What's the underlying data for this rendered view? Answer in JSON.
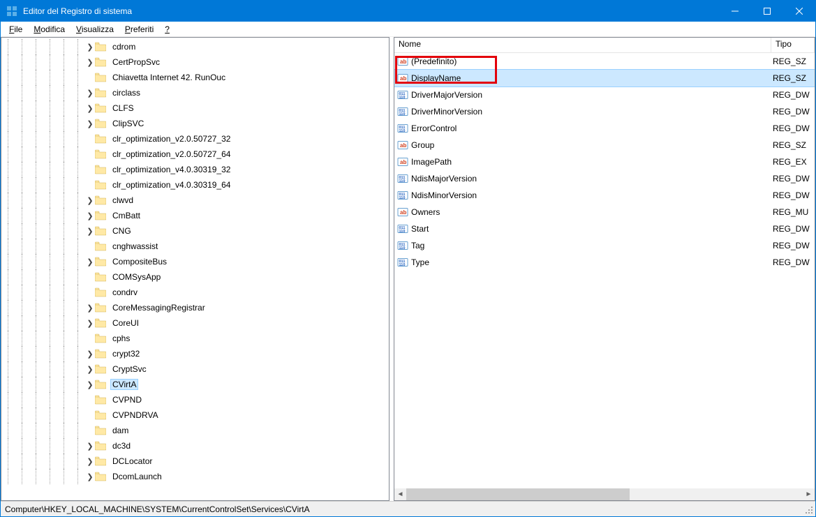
{
  "window": {
    "title": "Editor del Registro di sistema"
  },
  "menu": {
    "items": [
      {
        "label": "File",
        "accel": "F"
      },
      {
        "label": "Modifica",
        "accel": "M"
      },
      {
        "label": "Visualizza",
        "accel": "V"
      },
      {
        "label": "Preferiti",
        "accel": "P"
      },
      {
        "label": "?",
        "accel": "?"
      }
    ]
  },
  "tree": {
    "items": [
      {
        "label": "cdrom",
        "expandable": true
      },
      {
        "label": "CertPropSvc",
        "expandable": true
      },
      {
        "label": "Chiavetta Internet 42. RunOuc",
        "expandable": false
      },
      {
        "label": "circlass",
        "expandable": true
      },
      {
        "label": "CLFS",
        "expandable": true
      },
      {
        "label": "ClipSVC",
        "expandable": true
      },
      {
        "label": "clr_optimization_v2.0.50727_32",
        "expandable": false
      },
      {
        "label": "clr_optimization_v2.0.50727_64",
        "expandable": false
      },
      {
        "label": "clr_optimization_v4.0.30319_32",
        "expandable": false
      },
      {
        "label": "clr_optimization_v4.0.30319_64",
        "expandable": false
      },
      {
        "label": "clwvd",
        "expandable": true
      },
      {
        "label": "CmBatt",
        "expandable": true
      },
      {
        "label": "CNG",
        "expandable": true
      },
      {
        "label": "cnghwassist",
        "expandable": false
      },
      {
        "label": "CompositeBus",
        "expandable": true
      },
      {
        "label": "COMSysApp",
        "expandable": false
      },
      {
        "label": "condrv",
        "expandable": false
      },
      {
        "label": "CoreMessagingRegistrar",
        "expandable": true
      },
      {
        "label": "CoreUI",
        "expandable": true
      },
      {
        "label": "cphs",
        "expandable": false
      },
      {
        "label": "crypt32",
        "expandable": true
      },
      {
        "label": "CryptSvc",
        "expandable": true
      },
      {
        "label": "CVirtA",
        "expandable": true,
        "selected": true
      },
      {
        "label": "CVPND",
        "expandable": false
      },
      {
        "label": "CVPNDRVA",
        "expandable": false
      },
      {
        "label": "dam",
        "expandable": false
      },
      {
        "label": "dc3d",
        "expandable": true
      },
      {
        "label": "DCLocator",
        "expandable": true
      },
      {
        "label": "DcomLaunch",
        "expandable": true
      }
    ]
  },
  "list": {
    "columns": {
      "name": "Nome",
      "type": "Tipo"
    },
    "rows": [
      {
        "name": "(Predefinito)",
        "kind": "string",
        "type": "REG_SZ"
      },
      {
        "name": "DisplayName",
        "kind": "string",
        "type": "REG_SZ",
        "selected": true,
        "highlighted": true
      },
      {
        "name": "DriverMajorVersion",
        "kind": "dword",
        "type": "REG_DW"
      },
      {
        "name": "DriverMinorVersion",
        "kind": "dword",
        "type": "REG_DW"
      },
      {
        "name": "ErrorControl",
        "kind": "dword",
        "type": "REG_DW"
      },
      {
        "name": "Group",
        "kind": "string",
        "type": "REG_SZ"
      },
      {
        "name": "ImagePath",
        "kind": "string",
        "type": "REG_EX"
      },
      {
        "name": "NdisMajorVersion",
        "kind": "dword",
        "type": "REG_DW"
      },
      {
        "name": "NdisMinorVersion",
        "kind": "dword",
        "type": "REG_DW"
      },
      {
        "name": "Owners",
        "kind": "string",
        "type": "REG_MU"
      },
      {
        "name": "Start",
        "kind": "dword",
        "type": "REG_DW"
      },
      {
        "name": "Tag",
        "kind": "dword",
        "type": "REG_DW"
      },
      {
        "name": "Type",
        "kind": "dword",
        "type": "REG_DW"
      }
    ]
  },
  "status": {
    "path": "Computer\\HKEY_LOCAL_MACHINE\\SYSTEM\\CurrentControlSet\\Services\\CVirtA"
  },
  "colors": {
    "titlebar": "#0078d7",
    "selection": "#cce8ff",
    "highlight": "#e3000b"
  }
}
